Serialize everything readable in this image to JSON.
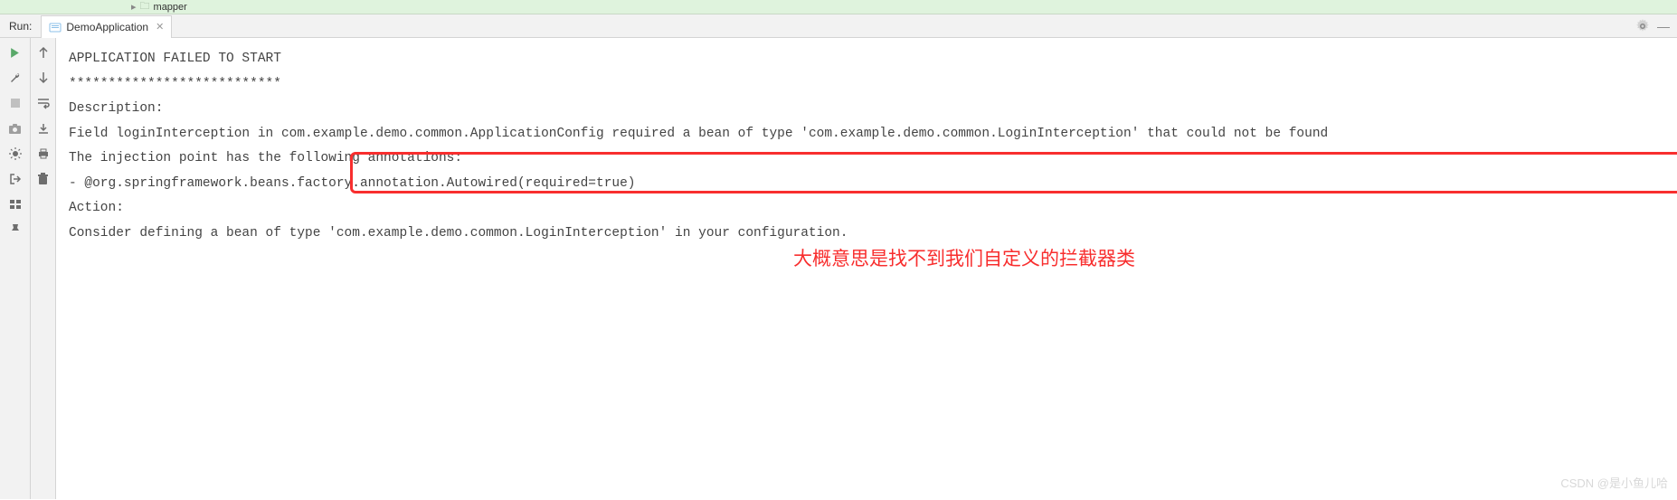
{
  "topBar": {
    "folderName": "mapper"
  },
  "runHeader": {
    "label": "Run:",
    "tabName": "DemoApplication"
  },
  "console": {
    "line1": "APPLICATION FAILED TO START",
    "line2": "***************************",
    "blank1": " ",
    "line3": "Description:",
    "blank2": " ",
    "line4_prefix": "Field loginInterception in ",
    "line4_highlighted": "com.example.demo.common.ApplicationConfig required a bean of type 'com.example.demo.common.LoginInterception' that could not be found",
    "blank3": " ",
    "line5": "The injection point has the following annotations:",
    "line6": "    - @org.springframework.beans.factory.annotation.Autowired(required=true)",
    "blank4": " ",
    "blank5": " ",
    "line7": "Action:",
    "blank6": " ",
    "line8": "Consider defining a bean of type 'com.example.demo.common.LoginInterception' in your configuration."
  },
  "annotation": "大概意思是找不到我们自定义的拦截器类",
  "watermark": "CSDN @是小鱼儿哈"
}
